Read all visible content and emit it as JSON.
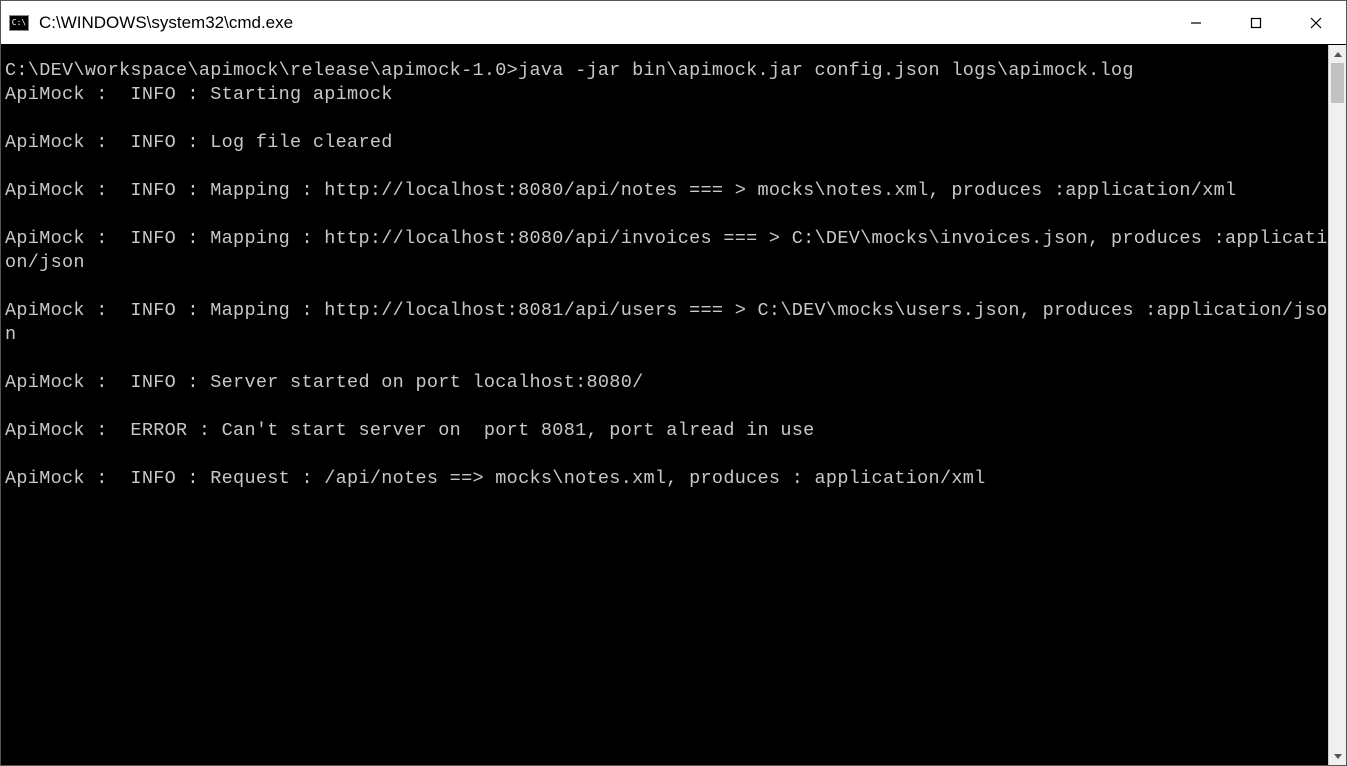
{
  "window": {
    "icon_text": "C:\\",
    "title": "C:\\WINDOWS\\system32\\cmd.exe"
  },
  "terminal": {
    "prompt": "C:\\DEV\\workspace\\apimock\\release\\apimock-1.0>",
    "command": "java -jar bin\\apimock.jar config.json logs\\apimock.log",
    "lines": [
      "ApiMock :  INFO : Starting apimock",
      "ApiMock :  INFO : Log file cleared",
      "ApiMock :  INFO : Mapping : http://localhost:8080/api/notes === > mocks\\notes.xml, produces :application/xml",
      "ApiMock :  INFO : Mapping : http://localhost:8080/api/invoices === > C:\\DEV\\mocks\\invoices.json, produces :application/json",
      "ApiMock :  INFO : Mapping : http://localhost:8081/api/users === > C:\\DEV\\mocks\\users.json, produces :application/json",
      "ApiMock :  INFO : Server started on port localhost:8080/",
      "ApiMock :  ERROR : Can't start server on  port 8081, port alread in use",
      "ApiMock :  INFO : Request : /api/notes ==> mocks\\notes.xml, produces : application/xml"
    ]
  }
}
